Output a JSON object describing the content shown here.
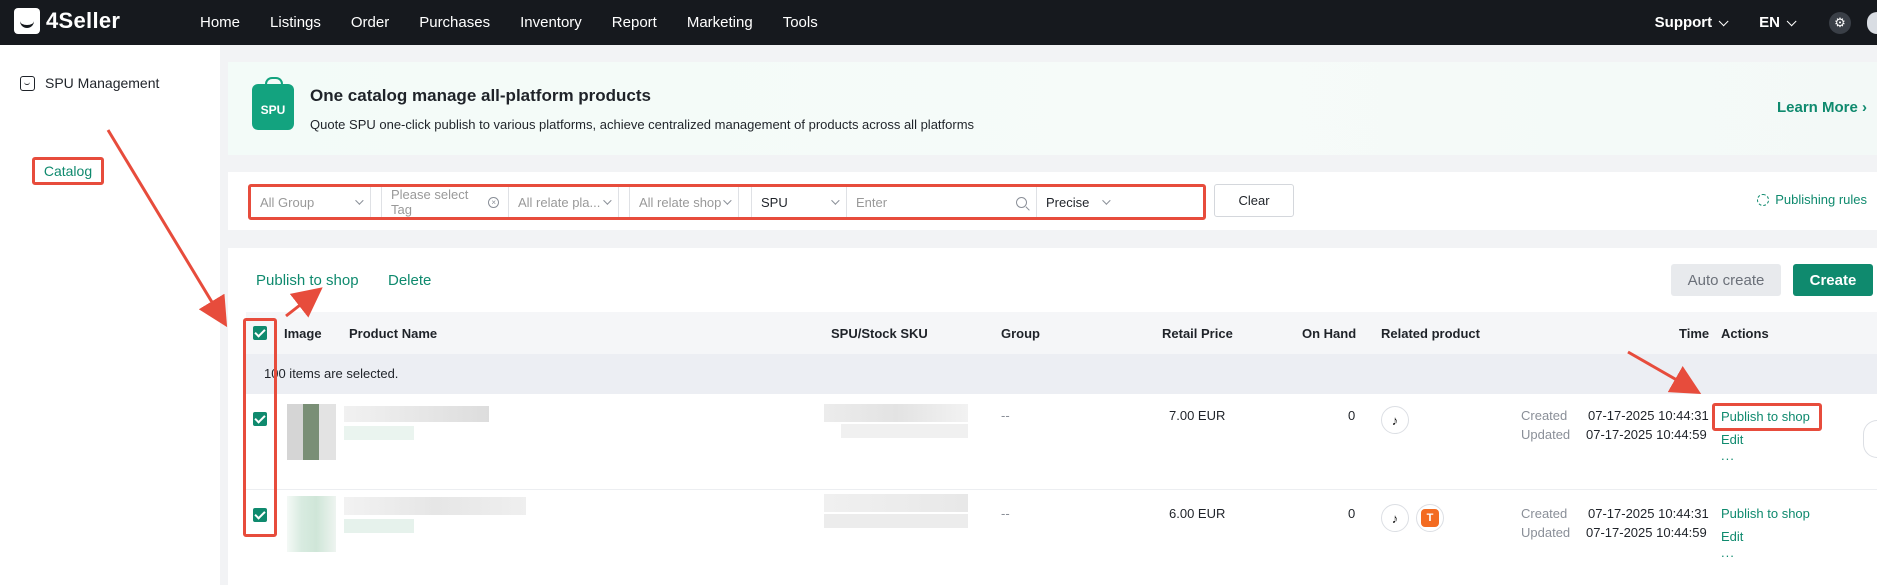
{
  "brand": {
    "name": "4Seller"
  },
  "nav": {
    "items": [
      "Home",
      "Listings",
      "Order",
      "Purchases",
      "Inventory",
      "Report",
      "Marketing",
      "Tools"
    ],
    "support": "Support",
    "language": "EN"
  },
  "sidebar": {
    "title": "SPU Management",
    "items": [
      {
        "label": "Catalog"
      }
    ]
  },
  "banner": {
    "badge": "SPU",
    "title": "One catalog manage all-platform products",
    "subtitle": "Quote SPU one-click publish to various platforms, achieve centralized management of products across all platforms",
    "learn_more": "Learn More"
  },
  "filters": {
    "group": "All Group",
    "tag_placeholder": "Please select Tag",
    "relate_platform": "All relate pla...",
    "relate_shop": "All relate shop",
    "search_type": "SPU",
    "search_placeholder": "Enter",
    "match_mode": "Precise",
    "clear": "Clear",
    "publishing_rules": "Publishing rules"
  },
  "toolbar": {
    "publish": "Publish to shop",
    "delete": "Delete",
    "auto_create": "Auto create",
    "create": "Create"
  },
  "table": {
    "columns": [
      "Image",
      "Product Name",
      "SPU/Stock SKU",
      "Group",
      "Retail Price",
      "On Hand",
      "Related product",
      "Time",
      "Actions"
    ],
    "selected_notice": "100 items are selected.",
    "rows": [
      {
        "group": "--",
        "price": "7.00 EUR",
        "on_hand": "0",
        "created_label": "Created",
        "created": "07-17-2025 10:44:31",
        "updated_label": "Updated",
        "updated": "07-17-2025 10:44:59",
        "actions": [
          "Publish to shop",
          "Edit",
          "..."
        ],
        "platforms": [
          "tiktok"
        ]
      },
      {
        "group": "--",
        "price": "6.00 EUR",
        "on_hand": "0",
        "created_label": "Created",
        "created": "07-17-2025 10:44:31",
        "updated_label": "Updated",
        "updated": "07-17-2025 10:44:59",
        "actions": [
          "Publish to shop",
          "Edit",
          "..."
        ],
        "platforms": [
          "tiktok",
          "temu"
        ]
      }
    ]
  },
  "icons": {
    "tiktok": "♪",
    "temu": "T",
    "gear": "⚙"
  },
  "colors": {
    "accent": "#0f8a6e",
    "topbar": "#16191e",
    "annotation": "#e74c3c"
  }
}
